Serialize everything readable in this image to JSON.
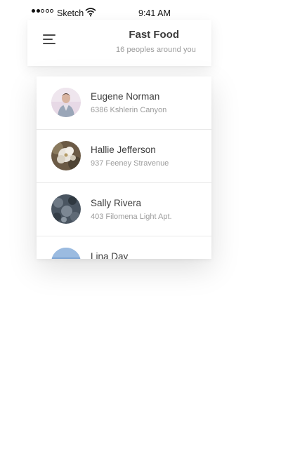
{
  "status_bar": {
    "carrier": "Sketch",
    "time": "9:41 AM",
    "signal_bars_filled": 2,
    "signal_bars_total": 5
  },
  "header": {
    "title": "Fast Food",
    "subtitle": "16 peoples around you",
    "menu_icon": "hamburger-menu-icon"
  },
  "people": [
    {
      "name": "Eugene Norman",
      "address": "6386 Kshlerin Canyon",
      "avatar": "portrait-photo"
    },
    {
      "name": "Hallie Jefferson",
      "address": "937 Feeney Stravenue",
      "avatar": "flower-photo"
    },
    {
      "name": "Sally Rivera",
      "address": "403 Filomena Light Apt.",
      "avatar": "dark-texture-photo"
    },
    {
      "name": "Lina Day",
      "address": "",
      "avatar": "sky-photo"
    }
  ],
  "colors": {
    "title": "#3c3c3c",
    "secondary_text": "#9a9a9a",
    "divider": "#e9e9e9"
  }
}
